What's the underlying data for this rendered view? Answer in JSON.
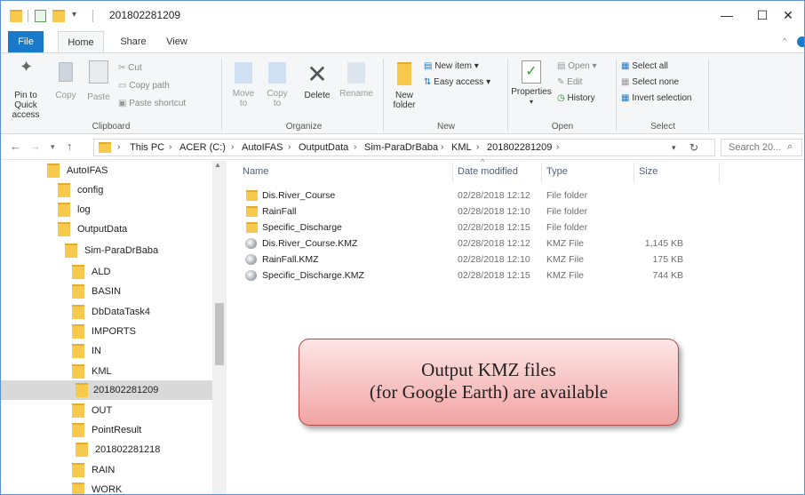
{
  "window": {
    "title": "201802281209",
    "controls": [
      "—",
      "☐",
      "✕"
    ]
  },
  "ribbon_tabs": [
    "File",
    "Home",
    "Share",
    "View"
  ],
  "ribbon": {
    "clipboard": {
      "pin": "Pin to Quick access",
      "copy": "Copy",
      "paste": "Paste",
      "cut": "Cut",
      "copy_path": "Copy path",
      "paste_shortcut": "Paste shortcut",
      "label": "Clipboard"
    },
    "organize": {
      "move": "Move to",
      "copy": "Copy to",
      "delete": "Delete",
      "rename": "Rename",
      "label": "Organize"
    },
    "new": {
      "new_folder": "New folder",
      "new_item": "New item ▾",
      "easy_access": "Easy access ▾",
      "label": "New"
    },
    "open": {
      "properties": "Properties",
      "open": "Open ▾",
      "edit": "Edit",
      "history": "History",
      "label": "Open"
    },
    "select": {
      "select_all": "Select all",
      "select_none": "Select none",
      "invert": "Invert selection",
      "label": "Select"
    }
  },
  "address": {
    "crumbs": [
      "This PC",
      "ACER (C:)",
      "AutoIFAS",
      "OutputData",
      "Sim-ParaDrBaba",
      "KML",
      "201802281209"
    ],
    "search_placeholder": "Search 20..."
  },
  "nav_tree": [
    {
      "label": "AutoIFAS"
    },
    {
      "label": "config"
    },
    {
      "label": "log"
    },
    {
      "label": "OutputData"
    },
    {
      "label": "Sim-ParaDrBaba"
    },
    {
      "label": "ALD"
    },
    {
      "label": "BASIN"
    },
    {
      "label": "DbDataTask4"
    },
    {
      "label": "IMPORTS"
    },
    {
      "label": "IN"
    },
    {
      "label": "KML"
    },
    {
      "label": "201802281209",
      "selected": true
    },
    {
      "label": "OUT"
    },
    {
      "label": "PointResult"
    },
    {
      "label": "201802281218"
    },
    {
      "label": "RAIN"
    },
    {
      "label": "WORK"
    }
  ],
  "columns": [
    "Name",
    "Date modified",
    "Type",
    "Size"
  ],
  "files": [
    {
      "name": "Dis.River_Course",
      "date": "02/28/2018 12:12",
      "type": "File folder",
      "size": "",
      "icon": "folder-icon"
    },
    {
      "name": "RainFall",
      "date": "02/28/2018 12:10",
      "type": "File folder",
      "size": "",
      "icon": "folder-icon"
    },
    {
      "name": "Specific_Discharge",
      "date": "02/28/2018 12:15",
      "type": "File folder",
      "size": "",
      "icon": "folder-icon"
    },
    {
      "name": "Dis.River_Course.KMZ",
      "date": "02/28/2018 12:12",
      "type": "KMZ File",
      "size": "1,145 KB",
      "icon": "kmz-file-icon"
    },
    {
      "name": "RainFall.KMZ",
      "date": "02/28/2018 12:10",
      "type": "KMZ File",
      "size": "175 KB",
      "icon": "kmz-file-icon"
    },
    {
      "name": "Specific_Discharge.KMZ",
      "date": "02/28/2018 12:15",
      "type": "KMZ File",
      "size": "744 KB",
      "icon": "kmz-file-icon"
    }
  ],
  "callout": {
    "line1": "Output KMZ files",
    "line2": "(for Google Earth) are available"
  },
  "colors": {
    "file_tab": "#1979ca",
    "folder": "#f7c94c",
    "callout_top": "#fde6e6",
    "callout_bottom": "#f2a3a3"
  }
}
